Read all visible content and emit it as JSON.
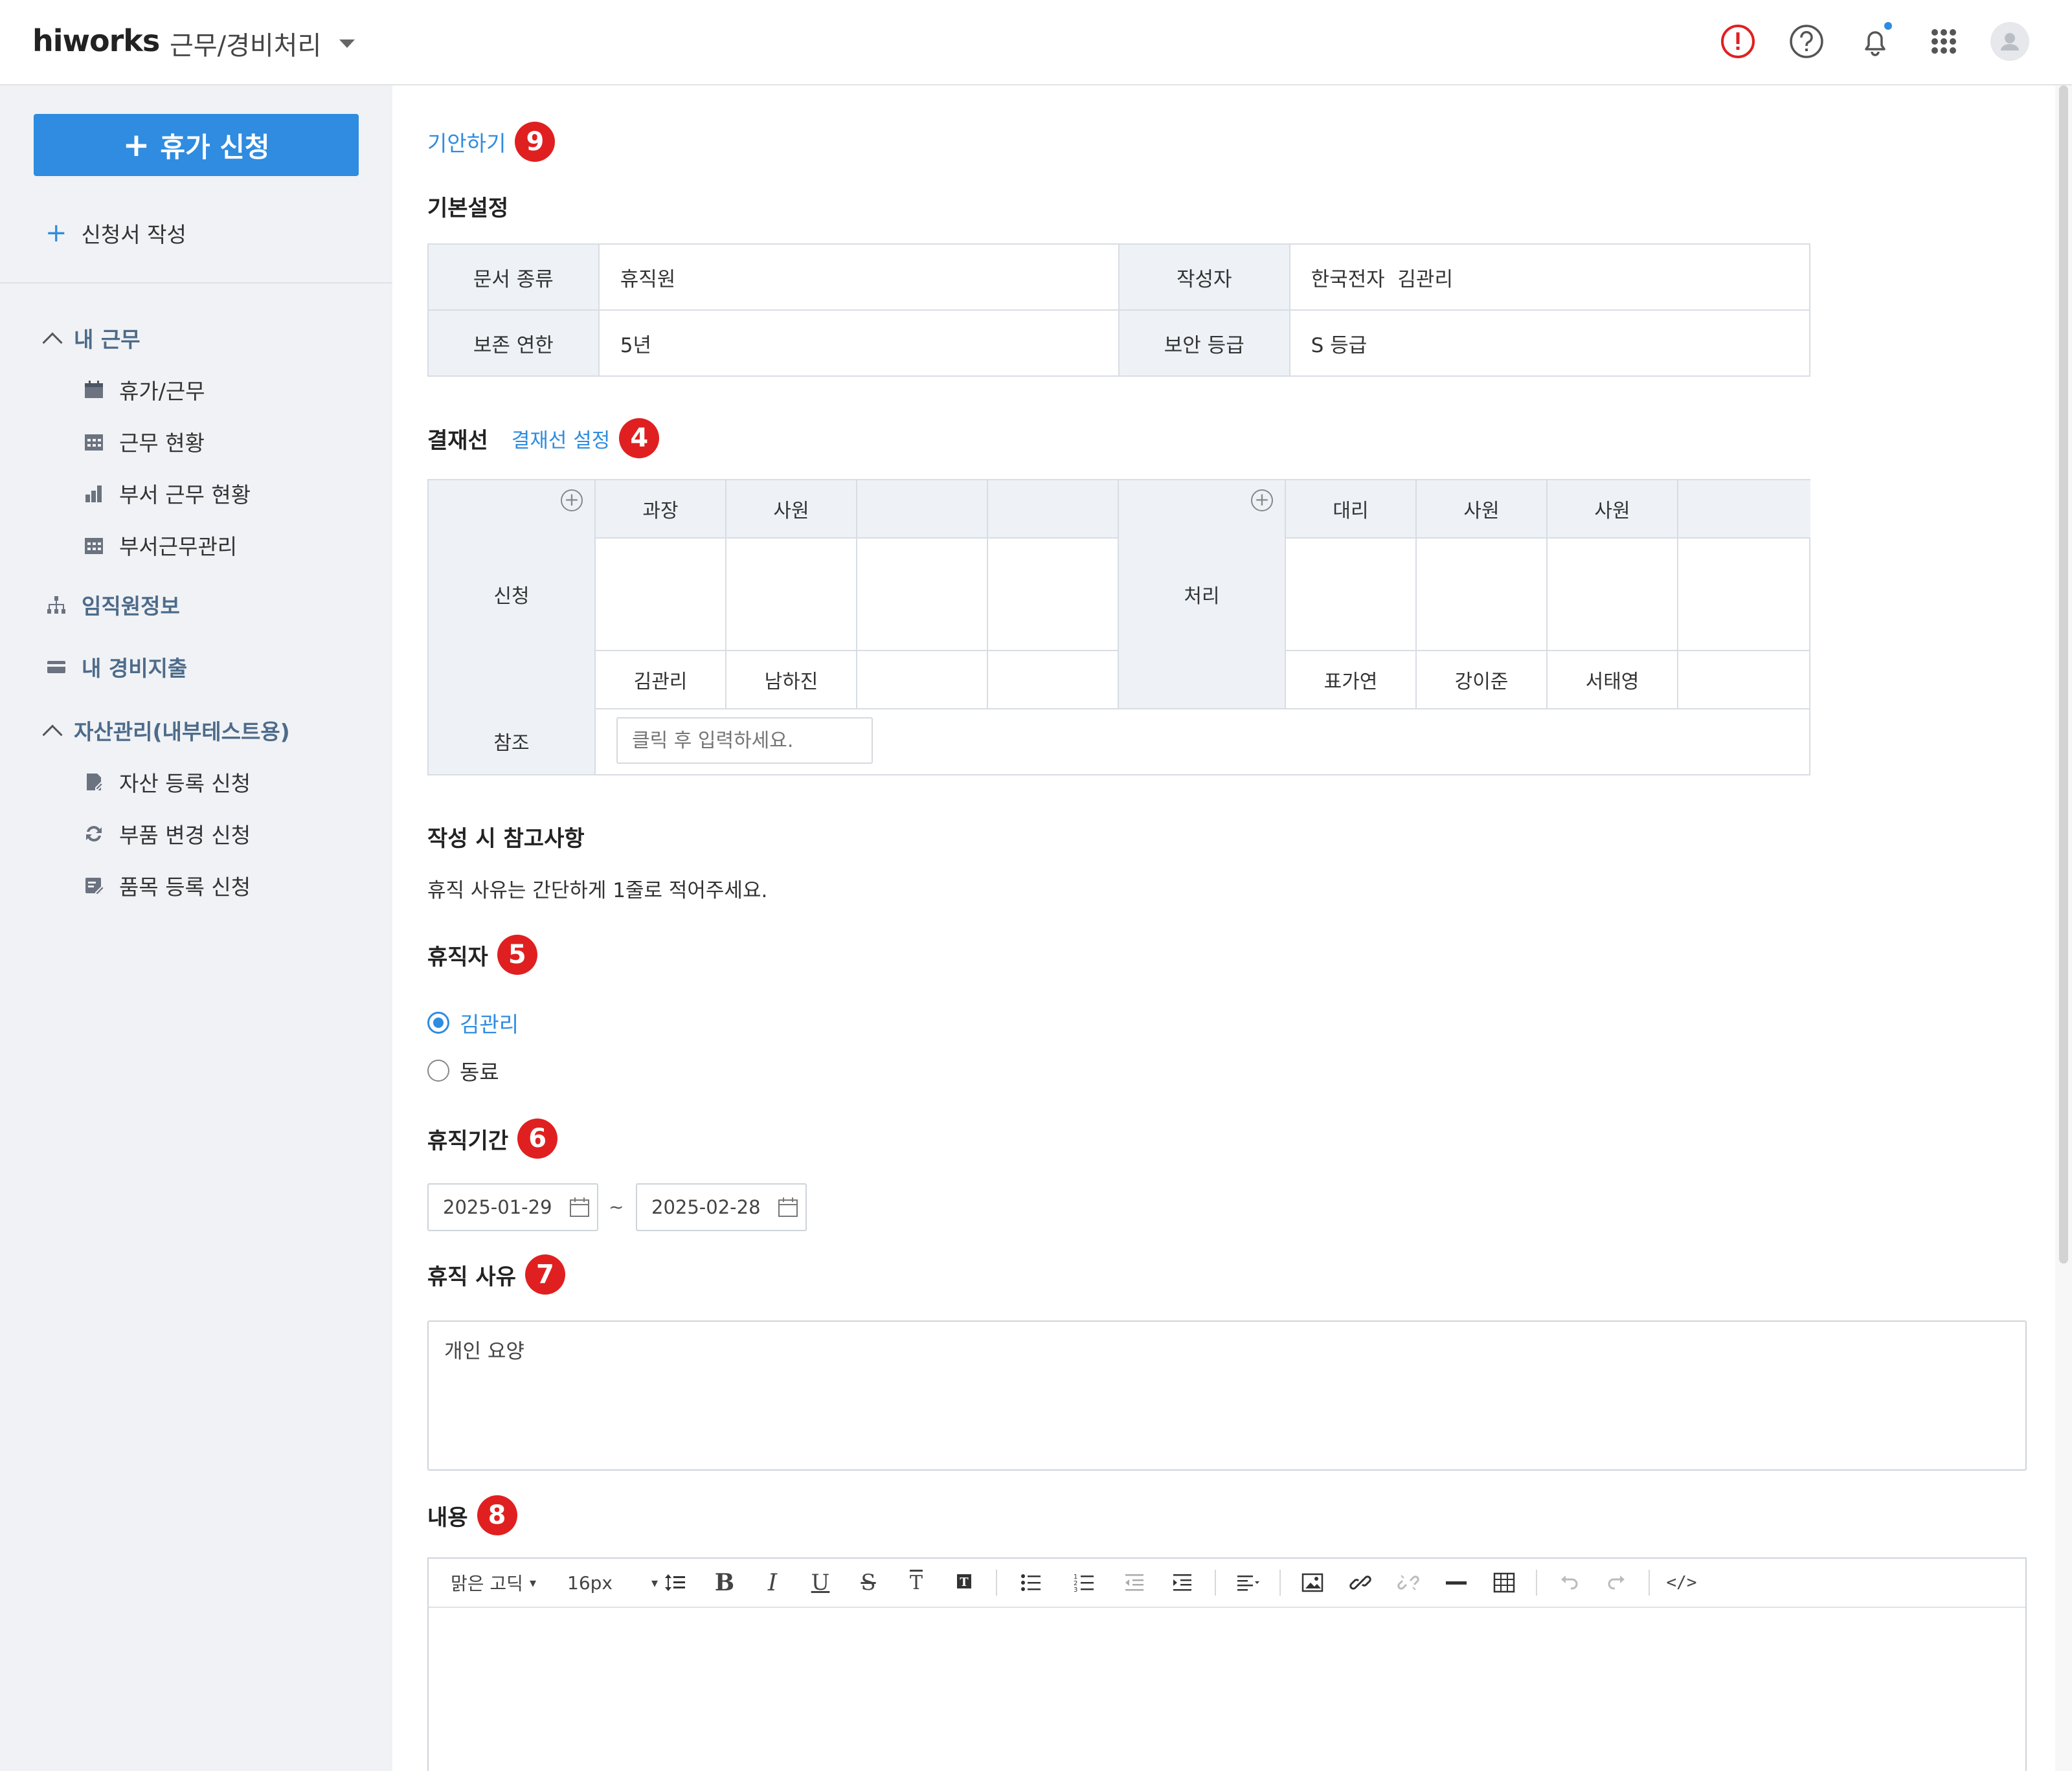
{
  "header": {
    "logo": "hiworks",
    "app_name": "근무/경비처리"
  },
  "sidebar": {
    "primary_button": "휴가 신청",
    "new_form": "신청서 작성",
    "sections": {
      "my_work": "내 근무",
      "my_work_items": [
        "휴가/근무",
        "근무 현황",
        "부서 근무 현황",
        "부서근무관리"
      ],
      "employee_info": "임직원정보",
      "my_expense": "내 경비지출",
      "asset": "자산관리(내부테스트용)",
      "asset_items": [
        "자산 등록 신청",
        "부품 변경 신청",
        "품목 등록 신청"
      ]
    }
  },
  "main": {
    "draft_link": "기안하기",
    "badges": [
      "9",
      "4",
      "5",
      "6",
      "7",
      "8"
    ],
    "basic": {
      "title": "기본설정",
      "doc_type_label": "문서 종류",
      "doc_type_value": "휴직원",
      "author_label": "작성자",
      "author_value": "한국전자  김관리",
      "retention_label": "보존 연한",
      "retention_value": "5년",
      "security_label": "보안 등급",
      "security_value": "S 등급"
    },
    "approval": {
      "title": "결재선",
      "setting_link": "결재선 설정",
      "request_label": "신청",
      "process_label": "처리",
      "request_ranks": [
        "과장",
        "사원",
        "",
        ""
      ],
      "request_names": [
        "김관리",
        "남하진",
        "",
        ""
      ],
      "process_ranks": [
        "대리",
        "사원",
        "사원",
        ""
      ],
      "process_names": [
        "표가연",
        "강이준",
        "서태영",
        ""
      ],
      "ref_label": "참조",
      "ref_placeholder": "클릭 후 입력하세요."
    },
    "notes": {
      "title": "작성 시 참고사항",
      "text": "휴직 사유는 간단하게 1줄로 적어주세요."
    },
    "leaver": {
      "title": "휴직자",
      "options": [
        "김관리",
        "동료"
      ],
      "selected": "김관리"
    },
    "period": {
      "title": "휴직기간",
      "start": "2025-01-29",
      "end": "2025-02-28",
      "separator": "~"
    },
    "reason": {
      "title": "휴직 사유",
      "value": "개인 요양"
    },
    "content": {
      "title": "내용",
      "font": "맑은 고딕",
      "size": "16px"
    }
  },
  "colors": {
    "accent": "#2f8ce0",
    "badge": "#e02020",
    "sidebar_bg": "#f0f2f5",
    "table_header_bg": "#eef2f7"
  }
}
